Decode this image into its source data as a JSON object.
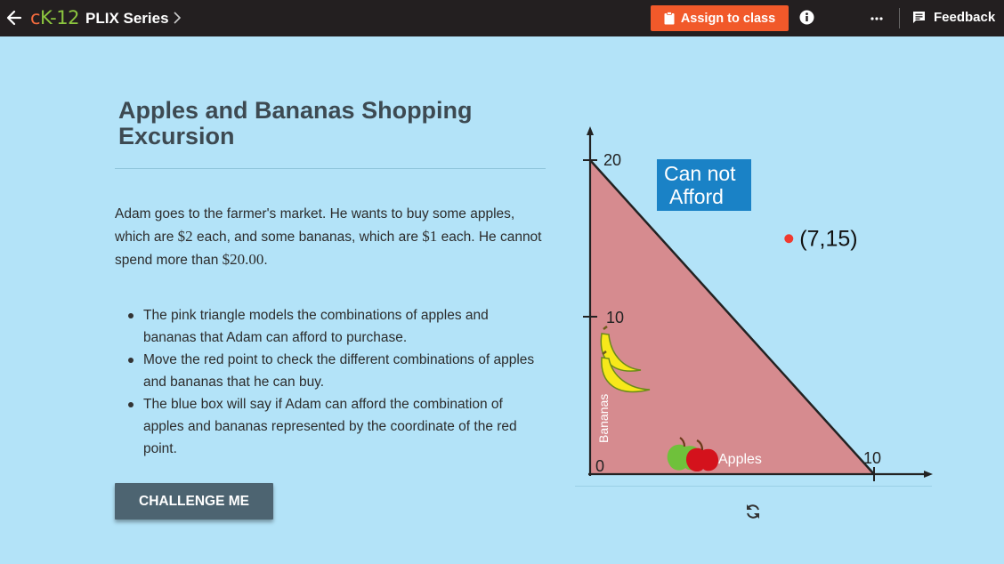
{
  "header": {
    "logo_c": "c",
    "logo_k": "K",
    "logo_num": "-12",
    "series_title": "PLIX Series",
    "assign_label": "Assign to class",
    "feedback_label": "Feedback"
  },
  "lesson": {
    "title": "Apples and Bananas Shopping Excursion",
    "intro_part1": "Adam goes to the farmer's market. He wants to buy some apples, which are ",
    "apple_price": "$2",
    "intro_part2": " each, and some bananas, which are ",
    "banana_price": "$1",
    "intro_part3": " each. He cannot spend more than ",
    "budget": "$20.00",
    "intro_part4": ".",
    "bullets": [
      "The pink triangle models the combinations of apples and bananas that Adam can afford to purchase.",
      "Move the red point to check the different combinations of apples and bananas that he can buy.",
      "The blue box will say if Adam can afford the combination of apples and bananas represented by the coordinate of the red point."
    ],
    "challenge_label": "CHALLENGE ME"
  },
  "graph": {
    "y_tick_20": "20",
    "y_tick_10": "10",
    "origin_label": "0",
    "x_tick_10": "10",
    "y_axis_label": "Bananas",
    "x_axis_label": "Apples",
    "status_line1": "Can not",
    "status_line2": "Afford",
    "point_label": "(7,15)",
    "point": {
      "apples": 7,
      "bananas": 15
    },
    "colors": {
      "triangle": "#d68b8f",
      "status_box": "#1a82c6",
      "point": "#f03a2f",
      "background": "#b3e3f8"
    }
  },
  "icons": {
    "back": "arrow-left-icon",
    "chevron": "chevron-right-icon",
    "clipboard": "clipboard-icon",
    "info": "info-icon",
    "more": "more-dots-icon",
    "feedback": "feedback-icon",
    "refresh": "refresh-icon"
  }
}
